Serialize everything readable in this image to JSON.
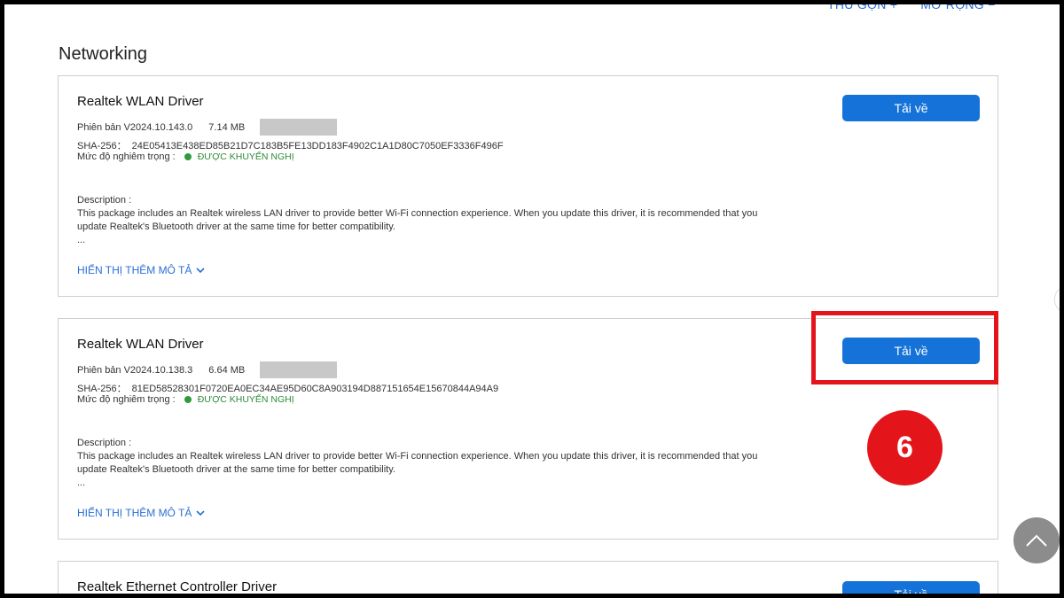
{
  "top_links": {
    "collapse": "THU GỌN +",
    "expand": "MỞ RỘNG −"
  },
  "section_title": "Networking",
  "drivers": [
    {
      "title": "Realtek WLAN Driver",
      "version": "Phiên bản V2024.10.143.0",
      "size": "7.14 MB",
      "sha_label": "SHA-256：",
      "sha": "24E05413E438ED85B21D7C183B5FE13DD183F4902C1A1D80C7050EF3336F496F",
      "severity_label": "Mức độ nghiêm trọng :",
      "severity": "ĐƯỢC KHUYẾN NGHỊ",
      "desc_label": "Description :",
      "desc_line1": "This package includes an Realtek wireless LAN driver to provide better Wi-Fi connection experience. When you update this driver, it is recommended that you",
      "desc_line2": "update Realtek's Bluetooth driver at the same time for better compatibility.",
      "desc_ellipsis": "...",
      "more_label": "HIỂN THỊ THÊM MÔ TẢ",
      "download_label": "Tải về"
    },
    {
      "title": "Realtek WLAN Driver",
      "version": "Phiên bản V2024.10.138.3",
      "size": "6.64 MB",
      "sha_label": "SHA-256：",
      "sha": "81ED58528301F0720EA0EC34AE95D60C8A903194D887151654E15670844A94A9",
      "severity_label": "Mức độ nghiêm trọng :",
      "severity": "ĐƯỢC KHUYẾN NGHỊ",
      "desc_label": "Description :",
      "desc_line1": "This package includes an Realtek wireless LAN driver to provide better Wi-Fi connection experience. When you update this driver, it is recommended that you",
      "desc_line2": "update Realtek's Bluetooth driver at the same time for better compatibility.",
      "desc_ellipsis": "...",
      "more_label": "HIỂN THỊ THÊM MÔ TẢ",
      "download_label": "Tải về"
    },
    {
      "title": "Realtek Ethernet Controller Driver",
      "download_label": "Tải về"
    }
  ],
  "step_badge": "6",
  "colors": {
    "accent": "#1472d8",
    "link": "#2a6fd6",
    "recommended": "#2e9a3a",
    "highlight": "#e4141b"
  },
  "icons": {
    "chevron": "chevron-down-icon",
    "scroll_top": "chevron-up-icon",
    "status_dot": "status-dot-icon"
  }
}
